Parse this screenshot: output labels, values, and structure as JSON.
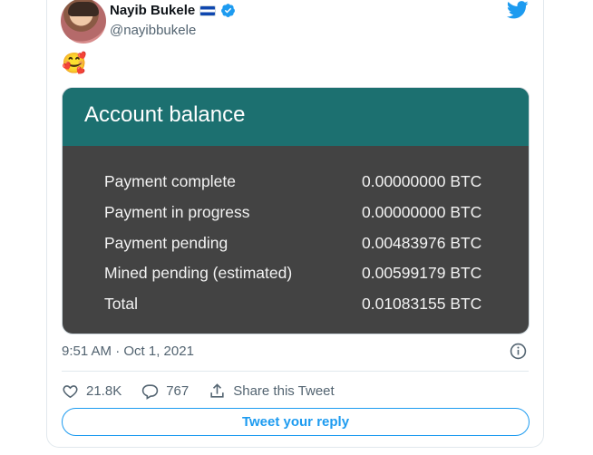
{
  "tweet": {
    "author_name": "Nayib Bukele",
    "author_handle": "@nayibbukele",
    "emoji": "🥰",
    "timestamp": "9:51 AM · Oct 1, 2021",
    "icons": {
      "flag": "el-salvador-flag-icon",
      "verified": "verified-badge-icon",
      "brand": "twitter-bird-icon",
      "info": "info-icon"
    },
    "colors": {
      "accent": "#1d9bf0",
      "card_header": "#1c7070",
      "card_body": "#434343"
    }
  },
  "balance_card": {
    "title": "Account balance",
    "rows": [
      {
        "label": "Payment complete",
        "value": "0.00000000 BTC"
      },
      {
        "label": "Payment in progress",
        "value": "0.00000000 BTC"
      },
      {
        "label": "Payment pending",
        "value": "0.00483976 BTC"
      },
      {
        "label": "Mined pending (estimated)",
        "value": "0.00599179 BTC"
      },
      {
        "label": "Total",
        "value": "0.01083155 BTC"
      }
    ]
  },
  "actions": {
    "likes": "21.8K",
    "replies": "767",
    "share_label": "Share this Tweet"
  },
  "reply_button": {
    "label": "Tweet your reply"
  }
}
